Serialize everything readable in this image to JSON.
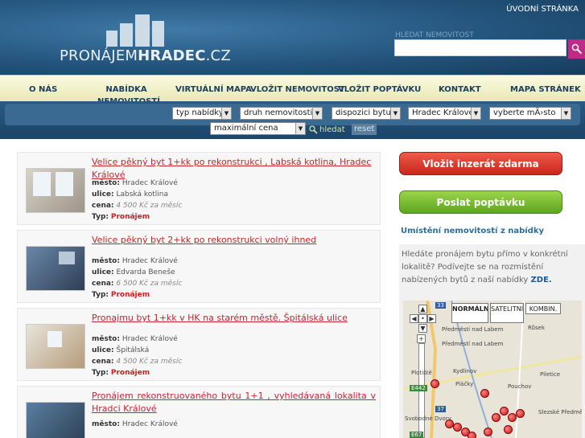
{
  "header": {
    "logo_text_light": "PRONÁJEM",
    "logo_text_bold": "HRADEC",
    "logo_text_suffix": ".CZ",
    "top_link": "ÚVODNÍ STRÁNKA",
    "search_label": "HLEDAT NEMOVITOST",
    "search_value": ""
  },
  "nav": {
    "items": [
      "O NÁS",
      "NABÍDKA NEMOVITOSTÍ",
      "VIRTUÁLNÍ MAPA",
      "VLOŽIT NEMOVITOST",
      "VLOŽIT POPTÁVKU",
      "KONTAKT",
      "MAPA STRÁNEK"
    ]
  },
  "filter": {
    "typ_nabidky": "typ nabídky",
    "druh": "druh nemovitosti",
    "dispozice": "dispozici bytu",
    "mesto": "Hradec Králové",
    "vyberte": "vyberte mÄ›sto",
    "cena": "maximální cena",
    "search_label": "hledat",
    "reset_label": "reset"
  },
  "listings": [
    {
      "title": "Velice pěkný byt 1+kk po rekonstrukci , Labská kotlina, Hradec Králové",
      "mesto_label": "město:",
      "mesto": "Hradec Králové",
      "ulice_label": "ulice:",
      "ulice": "Labská kotlina",
      "cena_label": "cena:",
      "cena": "4 500 Kč za měsíc",
      "typ_label": "Typ:",
      "typ": "Pronájem"
    },
    {
      "title": "Velice pěkný byt 2+kk po rekonstrukci volný ihned",
      "mesto_label": "město:",
      "mesto": "Hradec Králové",
      "ulice_label": "ulice:",
      "ulice": "Edvarda Beneše",
      "cena_label": "cena:",
      "cena": "6 500 Kč za měsíc",
      "typ_label": "Typ:",
      "typ": "Pronájem"
    },
    {
      "title": "Pronajmu byt 1+kk v HK na starém městě. Špitálská ulice",
      "mesto_label": "město:",
      "mesto": "Hradec Králové",
      "ulice_label": "ulice:",
      "ulice": "Špitálská",
      "cena_label": "cena:",
      "cena": "4 500 Kč za měsíc",
      "typ_label": "Typ:",
      "typ": "Pronájem"
    },
    {
      "title": "Pronájem rekonstruovaného bytu 1+1 , vyhledávaná lokalita v Hradci Králové",
      "mesto_label": "město:",
      "mesto": "Hradec Králové"
    }
  ],
  "sidebar": {
    "btn_insert": "Vložit inzerát zdarma",
    "btn_request": "Poslat poptávku",
    "heading": "Umístění nemovitostí z nabídky",
    "text": "Hledáte pronájem bytu přímo v konkrétní lokalitě? Podívejte se na rozmístění nabízených bytů z naší nabídky",
    "zde": "ZDE."
  },
  "map": {
    "type_normal": "NORMÁLNÍ",
    "type_satellite": "SATELITNÍ",
    "type_combined": "KOMBIN.",
    "road_33": "33",
    "road_e442": "E442",
    "road_37": "37",
    "road_e67": "E67",
    "labels": [
      "Předměstí nad Labem",
      "Předměstí nad Labem",
      "Růsek",
      "Kydlinov",
      "Plotiště",
      "Pláčky",
      "Piletice",
      "Pouchov",
      "Slezské Předměstí",
      "Svobodné Dvory"
    ]
  },
  "colors": {
    "header_bg": "#24557e",
    "nav_bg": "#f2f2cc",
    "title_red": "#c8242e",
    "type_red": "#d51d1d",
    "btn_red": "#d8362a",
    "btn_green": "#78bc34",
    "search_btn": "#c02a86"
  }
}
